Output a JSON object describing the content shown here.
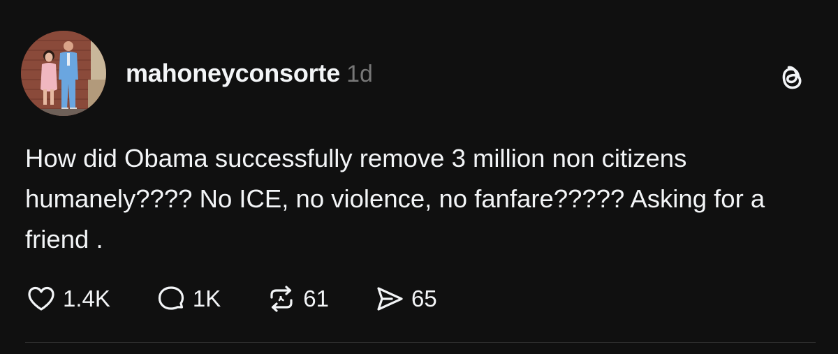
{
  "post": {
    "username": "mahoneyconsorte",
    "time": "1d",
    "text": "How did Obama successfully remove 3 million non citizens humanely???? No ICE, no violence, no fanfare????? Asking for a friend .",
    "avatar_icon": "profile-photo-avatar",
    "app_icon": "threads-logo-icon"
  },
  "actions": {
    "like": {
      "count": "1.4K",
      "icon": "heart-icon"
    },
    "reply": {
      "count": "1K",
      "icon": "comment-icon"
    },
    "repost": {
      "count": "61",
      "icon": "repost-icon"
    },
    "share": {
      "count": "65",
      "icon": "send-icon"
    }
  },
  "colors": {
    "background": "#101010",
    "text": "#f3f5f7",
    "muted": "#777777",
    "divider": "#2d2d2d"
  }
}
